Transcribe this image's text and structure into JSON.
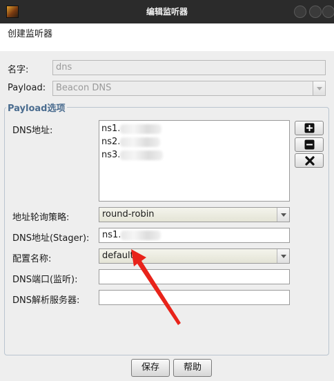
{
  "window": {
    "title": "编辑监听器"
  },
  "header": {
    "title": "创建监听器"
  },
  "form": {
    "name_label": "名字:",
    "name_value": "dns",
    "payload_label": "Payload:",
    "payload_value": "Beacon DNS"
  },
  "payload_group": {
    "title": "Payload选项",
    "dns_hosts_label": "DNS地址:",
    "dns_hosts": [
      "ns1.",
      "ns2.",
      "ns3."
    ],
    "rotation_label": "地址轮询策略:",
    "rotation_value": "round-robin",
    "stager_label": "DNS地址(Stager):",
    "stager_value": "ns1.",
    "profile_label": "配置名称:",
    "profile_value": "default",
    "port_label": "DNS端口(监听):",
    "port_value": "",
    "resolver_label": "DNS解析服务器:",
    "resolver_value": ""
  },
  "icons": [
    "app-icon",
    "add-icon",
    "remove-icon",
    "clear-icon"
  ],
  "buttons": {
    "save": "保存",
    "help": "帮助"
  },
  "annotation": {
    "arrow_color": "#e8231a"
  }
}
